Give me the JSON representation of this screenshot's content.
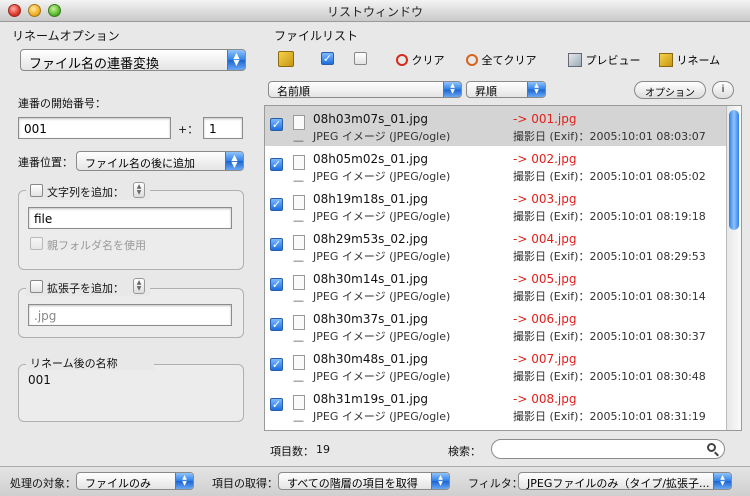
{
  "window": {
    "title": "リストウィンドウ"
  },
  "left": {
    "section_title": "リネームオプション",
    "mode_select": "ファイル名の連番変換",
    "start_number_label": "連番の開始番号：",
    "start_number_value": "001",
    "plus_label": "+：",
    "step_value": "1",
    "position_label": "連番位置：",
    "position_select": "ファイル名の後に追加",
    "add_string_label": "文字列を追加：",
    "add_string_value": "file",
    "parent_folder_label": "親フォルダ名を使用",
    "add_ext_label": "拡張子を追加：",
    "ext_placeholder": ".jpg",
    "result_title": "リネーム後の名称",
    "result_value": "001"
  },
  "right": {
    "section_title": "ファイルリスト",
    "toolbar": {
      "clear": "クリア",
      "clear_all": "全てクリア",
      "preview": "プレビュー",
      "rename": "リネーム"
    },
    "sort_select": "名前順",
    "order_select": "昇順",
    "options_button": "オプション",
    "info_button": "i",
    "rows": [
      {
        "name": "08h03m07s_01.jpg",
        "type": "JPEG イメージ (JPEG/ogle)",
        "new": "->  001.jpg",
        "exif": "撮影日 (Exif)：2005:10:01 08:03:07",
        "selected": true
      },
      {
        "name": "08h05m02s_01.jpg",
        "type": "JPEG イメージ (JPEG/ogle)",
        "new": "->  002.jpg",
        "exif": "撮影日 (Exif)：2005:10:01 08:05:02",
        "selected": false
      },
      {
        "name": "08h19m18s_01.jpg",
        "type": "JPEG イメージ (JPEG/ogle)",
        "new": "->  003.jpg",
        "exif": "撮影日 (Exif)：2005:10:01 08:19:18",
        "selected": false
      },
      {
        "name": "08h29m53s_02.jpg",
        "type": "JPEG イメージ (JPEG/ogle)",
        "new": "->  004.jpg",
        "exif": "撮影日 (Exif)：2005:10:01 08:29:53",
        "selected": false
      },
      {
        "name": "08h30m14s_01.jpg",
        "type": "JPEG イメージ (JPEG/ogle)",
        "new": "->  005.jpg",
        "exif": "撮影日 (Exif)：2005:10:01 08:30:14",
        "selected": false
      },
      {
        "name": "08h30m37s_01.jpg",
        "type": "JPEG イメージ (JPEG/ogle)",
        "new": "->  006.jpg",
        "exif": "撮影日 (Exif)：2005:10:01 08:30:37",
        "selected": false
      },
      {
        "name": "08h30m48s_01.jpg",
        "type": "JPEG イメージ (JPEG/ogle)",
        "new": "->  007.jpg",
        "exif": "撮影日 (Exif)：2005:10:01 08:30:48",
        "selected": false
      },
      {
        "name": "08h31m19s_01.jpg",
        "type": "JPEG イメージ (JPEG/ogle)",
        "new": "->  008.jpg",
        "exif": "撮影日 (Exif)：2005:10:01 08:31:19",
        "selected": false
      }
    ],
    "item_count_label": "項目数：",
    "item_count": "19",
    "search_label": "検索："
  },
  "bottom": {
    "target_label": "処理の対象：",
    "target_select": "ファイルのみ",
    "fetch_label": "項目の取得：",
    "fetch_select": "すべての階層の項目を取得",
    "filter_label": "フィルタ：",
    "filter_select": "JPEGファイルのみ（タイプ/拡張子..."
  }
}
